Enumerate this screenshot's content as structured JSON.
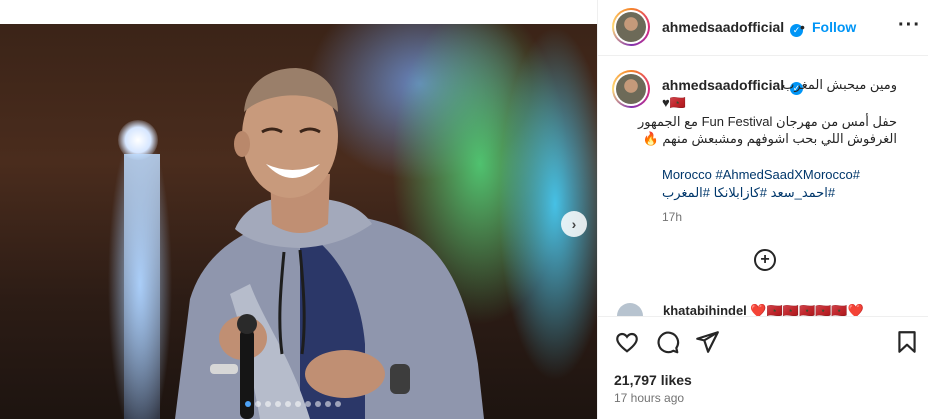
{
  "post": {
    "username": "ahmedsaadofficial",
    "separator": "•",
    "follow_label": "Follow",
    "more_label": "···",
    "verified_mark": "✓",
    "caption": {
      "line1": "ومين ميحبش المغرب",
      "line2": "♥🇲🇦",
      "line3": "حفل أمس من مهرجان Fun Festival مع الجمهور",
      "line4": "الغرفوش اللي بحب اشوفهم ومشبعش منهم 🔥"
    },
    "hashtags_line1": "Morocco #AhmedSaadXMorocco#",
    "hashtags_line2": "#احمد_سعد #كازابلانكا #المغرب",
    "caption_time": "17h",
    "add_comment_label": "+",
    "next_comment": {
      "text": "khatabihindel ❤️🇲🇦🇲🇦🇲🇦🇲🇦🇲🇦❤️"
    },
    "likes": "21,797 likes",
    "time_ago": "17 hours ago",
    "carousel_next_label": "›"
  },
  "icons": {
    "like": "heart-icon",
    "comment": "comment-icon",
    "share": "share-icon",
    "save": "bookmark-icon",
    "next": "chevron-right-icon",
    "add": "add-circle-icon"
  },
  "colors": {
    "accent": "#0095f6",
    "hashtag": "#00376b",
    "muted": "#737373",
    "text": "#262626"
  },
  "carousel": {
    "total": 10,
    "active_index": 0
  }
}
